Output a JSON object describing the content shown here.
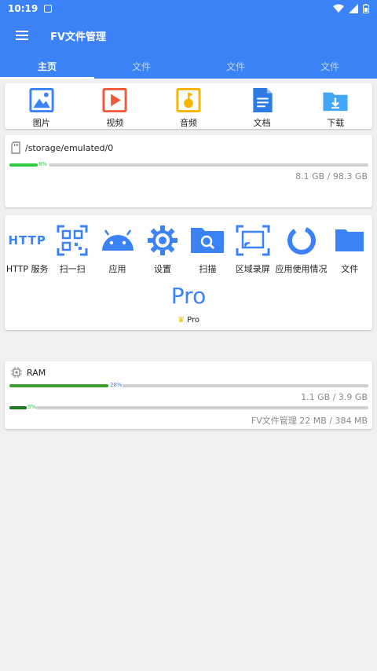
{
  "status": {
    "time": "10:19"
  },
  "app": {
    "title": "FV文件管理"
  },
  "tabs": [
    {
      "label": "主页",
      "active": true
    },
    {
      "label": "文件",
      "active": false
    },
    {
      "label": "文件",
      "active": false
    },
    {
      "label": "文件",
      "active": false
    }
  ],
  "categories": [
    {
      "label": "图片",
      "icon": "image-icon",
      "color": "#3b82f6"
    },
    {
      "label": "视频",
      "icon": "video-icon",
      "color": "#ef5a3a"
    },
    {
      "label": "音频",
      "icon": "audio-icon",
      "color": "#f4b400"
    },
    {
      "label": "文档",
      "icon": "document-icon",
      "color": "#2f7ae5"
    },
    {
      "label": "下载",
      "icon": "download-icon",
      "color": "#42a5f5"
    }
  ],
  "storage": {
    "path": "/storage/emulated/0",
    "percent": 8,
    "percent_label": "8%",
    "size_text": "8.1 GB  /  98.3 GB"
  },
  "tools": [
    {
      "label": "HTTP 服务",
      "icon": "http-icon"
    },
    {
      "label": "扫一扫",
      "icon": "qr-scan-icon"
    },
    {
      "label": "应用",
      "icon": "android-icon"
    },
    {
      "label": "设置",
      "icon": "gear-icon"
    },
    {
      "label": "扫描",
      "icon": "folder-search-icon"
    },
    {
      "label": "区域录屏",
      "icon": "screen-cast-icon"
    },
    {
      "label": "应用使用情况",
      "icon": "usage-ring-icon"
    },
    {
      "label": "文件",
      "icon": "folder-icon"
    }
  ],
  "http_icon_text": "HTTP",
  "pro": {
    "big": "Pro",
    "small": "Pro"
  },
  "ram": {
    "label": "RAM",
    "percent": 28,
    "percent_label": "28%",
    "size_text": "1.1 GB  /  3.9 GB",
    "app_percent": 5,
    "app_percent_label": "5%",
    "app_text": "FV文件管理  22 MB  /  384 MB"
  },
  "colors": {
    "primary": "#3b82f6",
    "storage_bar": "#2ecc40",
    "ram_bar": "#1e9b2f"
  }
}
